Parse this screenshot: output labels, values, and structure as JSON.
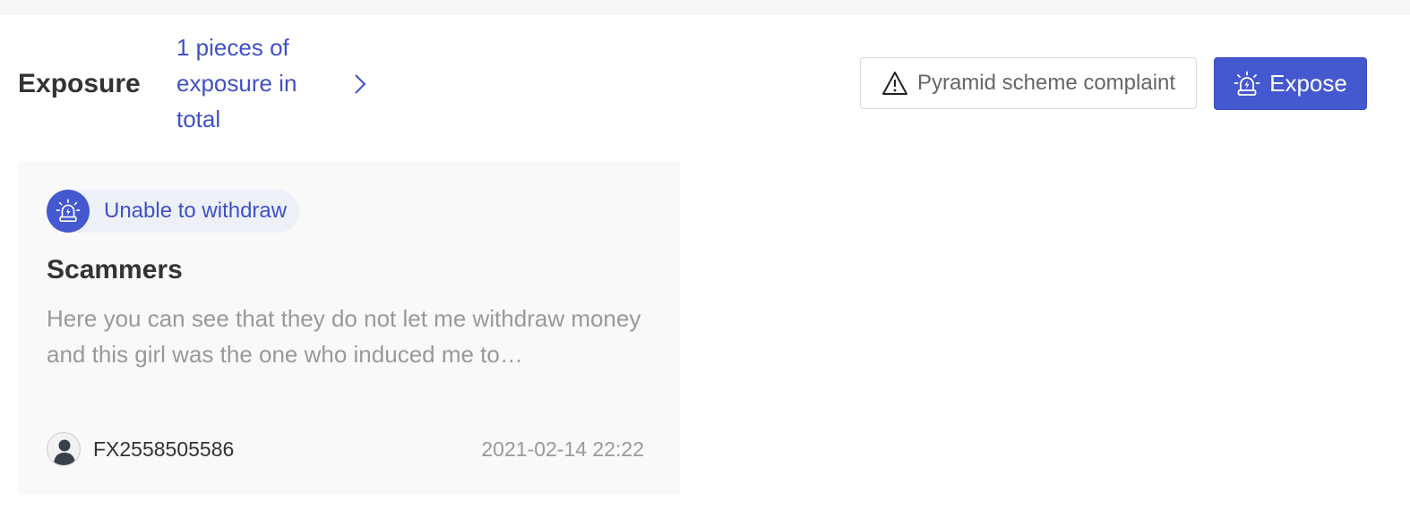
{
  "header": {
    "title": "Exposure",
    "total_link": "1 pieces of exposure in total"
  },
  "actions": {
    "complaint_label": "Pyramid scheme complaint",
    "expose_label": "Expose"
  },
  "cards": [
    {
      "tag": "Unable to withdraw",
      "title": "Scammers",
      "description": "Here you can see that they do not let me withdraw money and this girl was the one who induced me to…",
      "user": "FX2558505586",
      "date": "2021-02-14 22:22"
    }
  ],
  "colors": {
    "accent": "#4458d0",
    "link": "#3f51c7",
    "text": "#333333",
    "muted": "#999999",
    "card_bg": "#f9f9f9"
  },
  "icons": {
    "chevron": "chevron-right-icon",
    "warning": "warning-triangle-icon",
    "alarm": "alarm-siren-icon",
    "avatar": "user-avatar-icon"
  }
}
